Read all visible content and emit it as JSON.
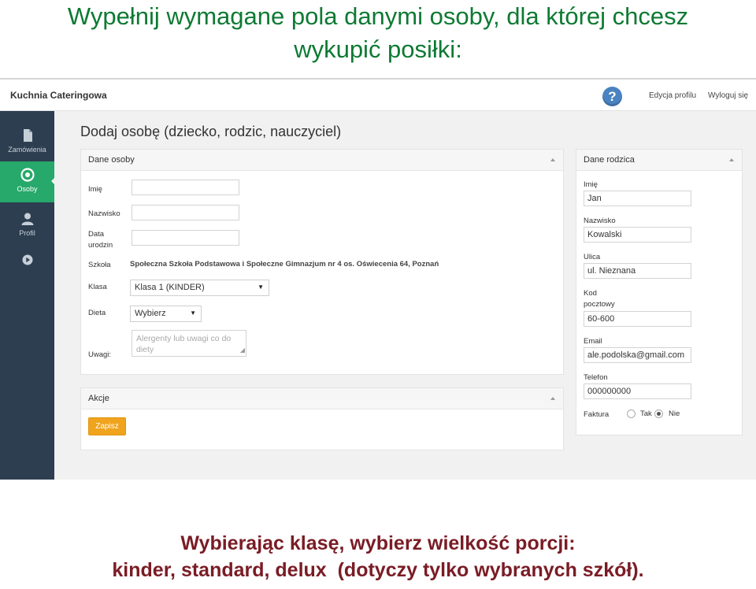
{
  "slide": {
    "title_line1": "Wypełnij wymagane pola danymi osoby, dla której chcesz",
    "title_line2": "wykupić posiłki:",
    "caption_line1": "Wybierając klasę, wybierz wielkość porcji:",
    "caption_line2": "kinder, standard, delux  (dotyczy tylko wybranych szkół)."
  },
  "topbar": {
    "app_name": "Kuchnia Cateringowa",
    "help_icon": "question-circle-icon",
    "edit_profile": "Edycja profilu",
    "logout": "Wyloguj się"
  },
  "sidebar": {
    "items": [
      {
        "label": "Zamówienia",
        "icon": "document-icon"
      },
      {
        "label": "Osoby",
        "icon": "target-icon",
        "active": true
      },
      {
        "label": "Profil",
        "icon": "user-icon"
      },
      {
        "label": "",
        "icon": "play-circle-icon"
      }
    ]
  },
  "page": {
    "heading": "Dodaj osobę (dziecko, rodzic, nauczyciel)"
  },
  "person_panel": {
    "title": "Dane osoby",
    "first_name_label": "Imię",
    "first_name_value": "",
    "last_name_label": "Nazwisko",
    "last_name_value": "",
    "birth_label_1": "Data",
    "birth_label_2": "urodzin",
    "birth_value": "",
    "school_label": "Szkoła",
    "school_value": "Społeczna Szkoła Podstawowa i Społeczne Gimnazjum nr 4 os. Oświecenia 64, Poznań",
    "class_label": "Klasa",
    "class_value": "Klasa 1 (KINDER)",
    "diet_label": "Dieta",
    "diet_value": "Wybierz",
    "notes_label": "Uwagi:",
    "notes_placeholder": "Alergenty lub uwagi co do diety"
  },
  "actions_panel": {
    "title": "Akcje",
    "save_label": "Zapisz"
  },
  "parent_panel": {
    "title": "Dane rodzica",
    "first_name_label": "Imię",
    "first_name_value": "Jan",
    "last_name_label": "Nazwisko",
    "last_name_value": "Kowalski",
    "street_label": "Ulica",
    "street_value": "ul. Nieznana",
    "postal_label_1": "Kod",
    "postal_label_2": "pocztowy",
    "postal_value": "60-600",
    "email_label": "Email",
    "email_value": "ale.podolska@gmail.com",
    "phone_label": "Telefon",
    "phone_value": "000000000",
    "invoice_label": "Faktura",
    "invoice_yes": "Tak",
    "invoice_no": "Nie",
    "invoice_selected": "Nie"
  },
  "colors": {
    "title_green": "#0e7a33",
    "caption_red": "#7a1c25",
    "sidebar_bg": "#2d3e50",
    "sidebar_active": "#26a96a",
    "save_button": "#f0a31d"
  }
}
